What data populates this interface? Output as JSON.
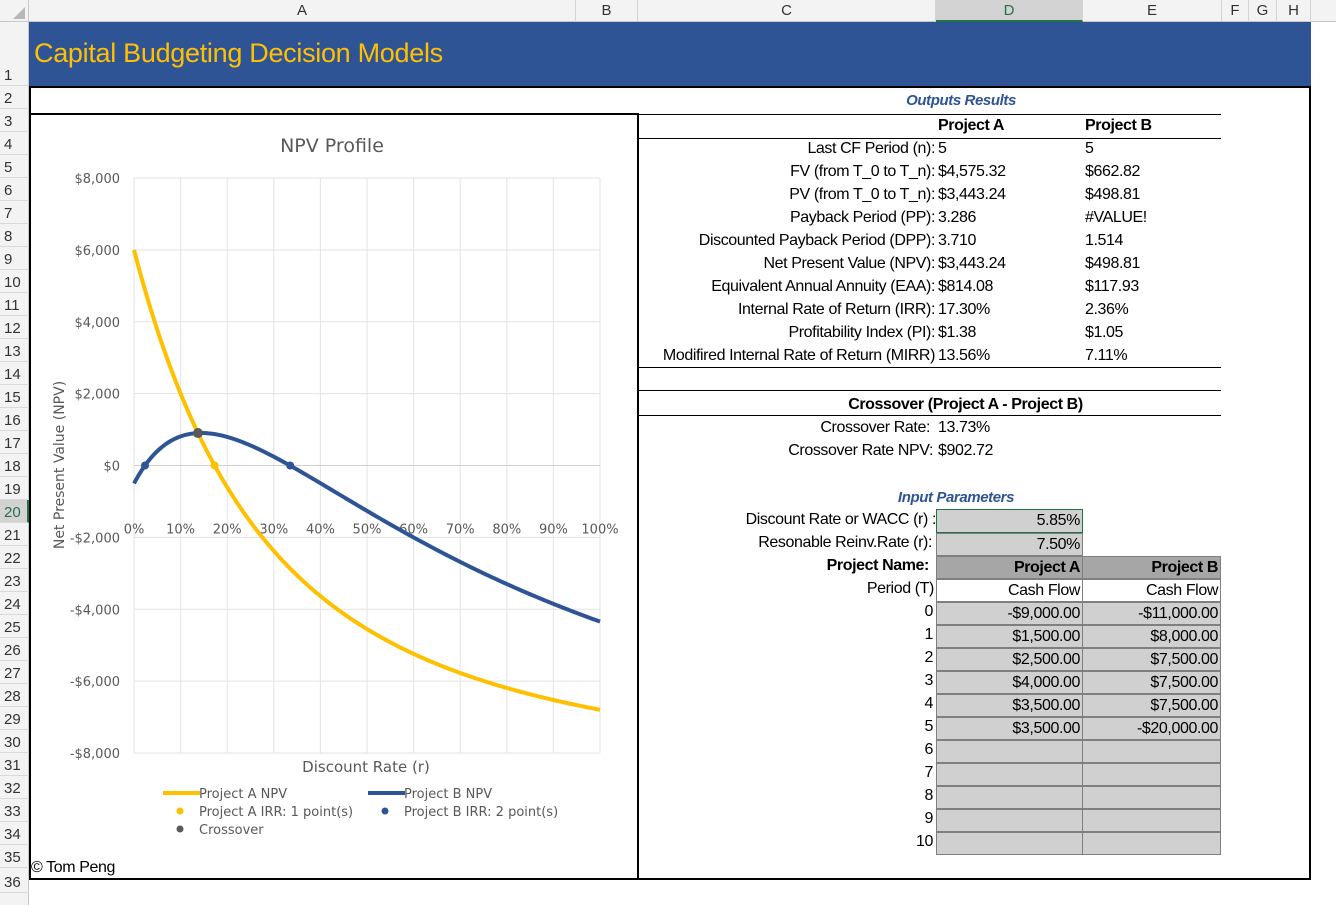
{
  "spreadsheet": {
    "columns": [
      "A",
      "B",
      "C",
      "D",
      "E",
      "F",
      "G",
      "H"
    ],
    "selected_column": "D",
    "rows": [
      "1",
      "2",
      "3",
      "4",
      "5",
      "6",
      "7",
      "8",
      "9",
      "10",
      "11",
      "12",
      "13",
      "14",
      "15",
      "16",
      "17",
      "18",
      "19",
      "20",
      "21",
      "22",
      "23",
      "24",
      "25",
      "26",
      "27",
      "28",
      "29",
      "30",
      "31",
      "32",
      "33",
      "34",
      "35",
      "36"
    ],
    "selected_row": "20"
  },
  "banner": {
    "title": "Capital Budgeting Decision Models"
  },
  "footer": {
    "credit": "© Tom Peng"
  },
  "outputs": {
    "heading": "Outputs Results",
    "col_a": "Project A",
    "col_b": "Project B",
    "rows": [
      {
        "label": "Last CF Period (n):",
        "a": "5",
        "b": "5"
      },
      {
        "label": "FV (from T_0 to T_n):",
        "a": "$4,575.32",
        "b": "$662.82"
      },
      {
        "label": "PV (from T_0 to T_n):",
        "a": "$3,443.24",
        "b": "$498.81"
      },
      {
        "label": "Payback Period (PP):",
        "a": "3.286",
        "b": "#VALUE!"
      },
      {
        "label": "Discounted Payback Period (DPP):",
        "a": "3.710",
        "b": "1.514"
      },
      {
        "label": "Net Present Value (NPV):",
        "a": "$3,443.24",
        "b": "$498.81"
      },
      {
        "label": "Equivalent Annual Annuity (EAA):",
        "a": "$814.08",
        "b": "$117.93"
      },
      {
        "label": "Internal Rate of Return (IRR):",
        "a": "17.30%",
        "b": "2.36%"
      },
      {
        "label": "Profitability Index (PI):",
        "a": "$1.38",
        "b": "$1.05"
      },
      {
        "label": "Modifired Internal Rate of Return (MIRR)",
        "a": "13.56%",
        "b": "7.11%"
      }
    ]
  },
  "crossover": {
    "heading": "Crossover (Project A - Project B)",
    "rate_label": "Crossover Rate:",
    "rate_value": "13.73%",
    "npv_label": "Crossover Rate NPV:",
    "npv_value": "$902.72"
  },
  "inputs": {
    "heading": "Input Parameters",
    "wacc_label": "Discount Rate or WACC (r) :",
    "wacc_value": "5.85%",
    "reinv_label": "Resonable Reinv.Rate (r):",
    "reinv_value": "7.50%",
    "name_label": "Project Name:",
    "name_a": "Project A",
    "name_b": "Project B",
    "period_label": "Period (T)",
    "cf_label_a": "Cash Flow",
    "cf_label_b": "Cash Flow",
    "periods": [
      "0",
      "1",
      "2",
      "3",
      "4",
      "5",
      "6",
      "7",
      "8",
      "9",
      "10"
    ],
    "cf_a": [
      "-$9,000.00",
      "$1,500.00",
      "$2,500.00",
      "$4,000.00",
      "$3,500.00",
      "$3,500.00",
      "",
      "",
      "",
      "",
      ""
    ],
    "cf_b": [
      "-$11,000.00",
      "$8,000.00",
      "$7,500.00",
      "$7,500.00",
      "$7,500.00",
      "-$20,000.00",
      "",
      "",
      "",
      "",
      ""
    ]
  },
  "chart_data": {
    "type": "line",
    "title": "NPV Profile",
    "xlabel": "Discount Rate (r)",
    "ylabel": "Net Present Value (NPV)",
    "xlim": [
      0,
      1
    ],
    "ylim": [
      -8000,
      8000
    ],
    "x_ticks": [
      "0%",
      "10%",
      "20%",
      "30%",
      "40%",
      "50%",
      "60%",
      "70%",
      "80%",
      "90%",
      "100%"
    ],
    "y_ticks": [
      "$8,000",
      "$6,000",
      "$4,000",
      "$2,000",
      "$0",
      "-$2,000",
      "-$4,000",
      "-$6,000",
      "-$8,000"
    ],
    "y_tick_values": [
      8000,
      6000,
      4000,
      2000,
      0,
      -2000,
      -4000,
      -6000,
      -8000
    ],
    "grid": true,
    "legend_position": "bottom",
    "series": [
      {
        "name": "Project A NPV",
        "color": "#ffc000",
        "cash_flows": [
          -9000,
          1500,
          2500,
          4000,
          3500,
          3500
        ]
      },
      {
        "name": "Project B NPV",
        "color": "#2f5496",
        "cash_flows": [
          -11000,
          8000,
          7500,
          7500,
          7500,
          -20000
        ]
      }
    ],
    "markers": [
      {
        "name": "Project A IRR: 1 point(s)",
        "color": "#ffc000",
        "points": [
          [
            0.173,
            0
          ]
        ]
      },
      {
        "name": "Project B IRR: 2 point(s)",
        "color": "#2f5496",
        "points": [
          [
            0.0236,
            0
          ],
          [
            0.335,
            0
          ]
        ]
      },
      {
        "name": "Crossover",
        "color": "#595959",
        "points": [
          [
            0.1373,
            902.72
          ]
        ]
      }
    ]
  }
}
